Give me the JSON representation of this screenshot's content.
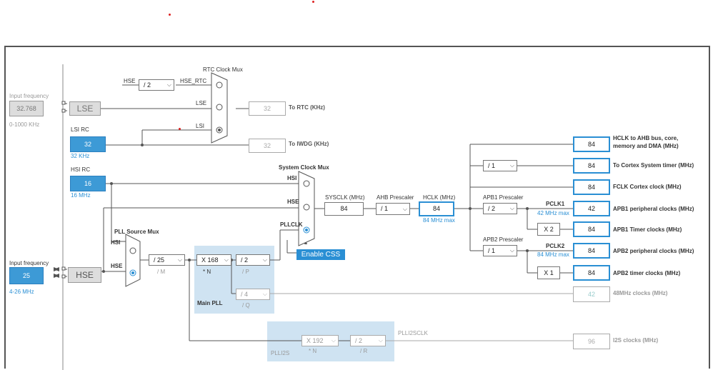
{
  "top": {
    "dots": 2
  },
  "input_freq": {
    "label": "Input frequency",
    "value": "32.768",
    "range": "0-1000 KHz"
  },
  "lse": {
    "label": "LSE"
  },
  "lsi": {
    "label": "LSI RC",
    "value": "32",
    "unit": "32 KHz"
  },
  "hsi": {
    "label": "HSI RC",
    "value": "16",
    "unit": "16 MHz"
  },
  "hse_input": {
    "label": "Input frequency",
    "value": "25",
    "range": "4-26 MHz"
  },
  "hse": {
    "label": "HSE"
  },
  "rtc_mux": {
    "title": "RTC Clock Mux",
    "hse_label": "HSE",
    "hse_div": "/ 2",
    "hse_rtc": "HSE_RTC",
    "lse_in": "LSE",
    "lsi_in": "LSI"
  },
  "rtc_out": {
    "value": "32",
    "label": "To RTC (KHz)"
  },
  "iwdg_out": {
    "value": "32",
    "label": "To IWDG (KHz)"
  },
  "sys_mux": {
    "title": "System Clock Mux",
    "hsi": "HSI",
    "hse": "HSE",
    "pllclk": "PLLCLK"
  },
  "enable_css": "Enable CSS",
  "sysclk": {
    "label": "SYSCLK (MHz)",
    "value": "84"
  },
  "ahb": {
    "label": "AHB Prescaler",
    "value": "/ 1"
  },
  "hclk": {
    "label": "HCLK (MHz)",
    "value": "84",
    "max": "84 MHz max"
  },
  "pll_src_mux": {
    "title": "PLL Source Mux",
    "hsi": "HSI",
    "hse": "HSE"
  },
  "pll_m": {
    "value": "/ 25",
    "label": "/ M"
  },
  "pll_n": {
    "value": "X 168",
    "label": "* N"
  },
  "pll_p": {
    "value": "/ 2",
    "label": "/ P"
  },
  "pll_q": {
    "value": "/ 4",
    "label": "/ Q"
  },
  "main_pll": "Main PLL",
  "plli2s": {
    "label": "PLLI2S",
    "n": "X 192",
    "n_label": "* N",
    "r": "/ 2",
    "r_label": "/ R",
    "clk": "PLLI2SCLK"
  },
  "cortex_div": "/ 1",
  "apb1": {
    "label": "APB1 Prescaler",
    "value": "/ 2",
    "pclk": "PCLK1",
    "max": "42 MHz max",
    "timer_mul": "X 2"
  },
  "apb2": {
    "label": "APB2 Prescaler",
    "value": "/ 1",
    "pclk": "PCLK2",
    "max": "84 MHz max",
    "timer_mul": "X 1"
  },
  "outputs": [
    {
      "value": "84",
      "label": "HCLK to AHB bus, core,",
      "label2": "memory and DMA (MHz)"
    },
    {
      "value": "84",
      "label": "To Cortex System timer (MHz)"
    },
    {
      "value": "84",
      "label": "FCLK Cortex clock (MHz)"
    },
    {
      "value": "42",
      "label": "APB1 peripheral clocks (MHz)"
    },
    {
      "value": "84",
      "label": "APB1 Timer clocks (MHz)"
    },
    {
      "value": "84",
      "label": "APB2 peripheral clocks (MHz)"
    },
    {
      "value": "84",
      "label": "APB2 timer clocks (MHz)"
    },
    {
      "value": "42",
      "label": "48MHz clocks (MHz)"
    },
    {
      "value": "96",
      "label": "I2S clocks (MHz)"
    }
  ]
}
